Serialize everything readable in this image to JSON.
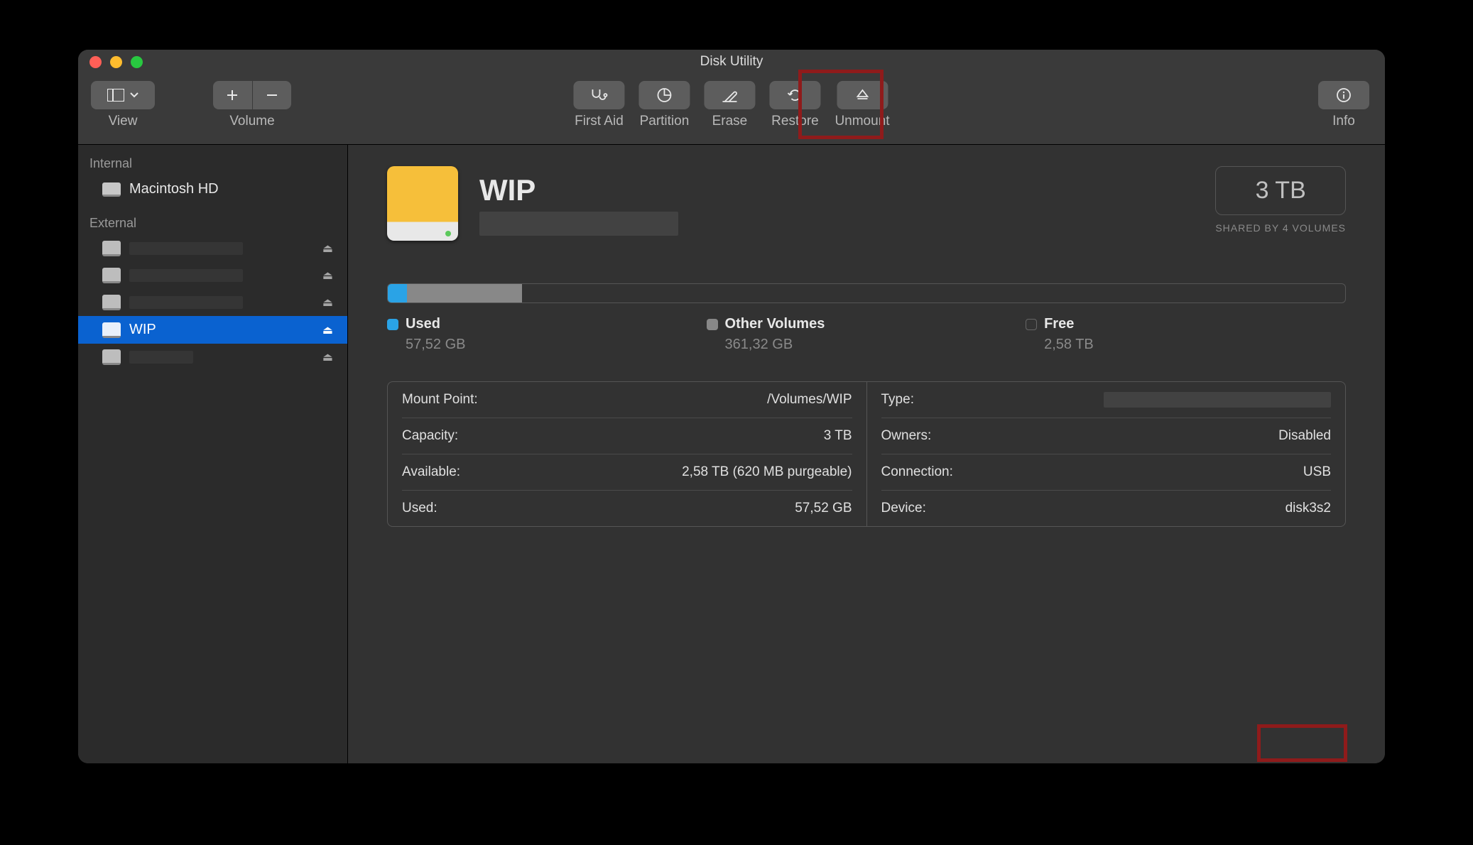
{
  "window": {
    "title": "Disk Utility"
  },
  "toolbar": {
    "view_label": "View",
    "volume_label": "Volume",
    "first_aid_label": "First Aid",
    "partition_label": "Partition",
    "erase_label": "Erase",
    "restore_label": "Restore",
    "unmount_label": "Unmount",
    "info_label": "Info"
  },
  "sidebar": {
    "internal_header": "Internal",
    "external_header": "External",
    "internal": [
      {
        "name": "Macintosh HD"
      }
    ],
    "external": [
      {
        "name": "",
        "eject": true
      },
      {
        "name": "",
        "eject": true
      },
      {
        "name": "",
        "eject": true
      },
      {
        "name": "WIP",
        "eject": true,
        "selected": true
      },
      {
        "name": "",
        "eject": true
      }
    ]
  },
  "main": {
    "volume_name": "WIP",
    "capacity": "3 TB",
    "shared_by": "SHARED BY 4 VOLUMES",
    "legend": {
      "used_label": "Used",
      "used_value": "57,52 GB",
      "other_label": "Other Volumes",
      "other_value": "361,32 GB",
      "free_label": "Free",
      "free_value": "2,58 TB"
    },
    "details": {
      "mount_point_label": "Mount Point:",
      "mount_point_value": "/Volumes/WIP",
      "capacity_label": "Capacity:",
      "capacity_value": "3 TB",
      "available_label": "Available:",
      "available_value": "2,58 TB (620 MB purgeable)",
      "used_label": "Used:",
      "used_value": "57,52 GB",
      "type_label": "Type:",
      "type_value": "",
      "owners_label": "Owners:",
      "owners_value": "Disabled",
      "connection_label": "Connection:",
      "connection_value": "USB",
      "device_label": "Device:",
      "device_value": "disk3s2"
    }
  }
}
